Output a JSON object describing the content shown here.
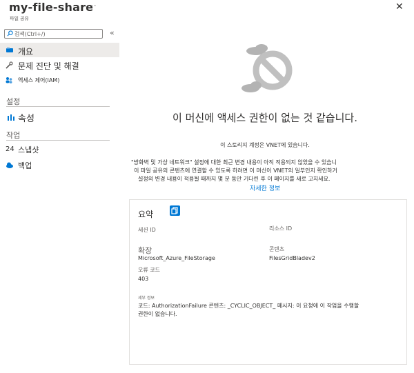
{
  "header": {
    "title": "my-file-share",
    "subtitle": "파일 공유",
    "more_glyph": "···",
    "close_glyph": "✕"
  },
  "search": {
    "placeholder": "검색(Ctrl+/)",
    "collapse_glyph": "«"
  },
  "nav": {
    "overview": "개요",
    "diagnose": "문제 진단 및 해결",
    "iam": "액세스 제어(IAM)",
    "section_settings": "설정",
    "properties": "속성",
    "section_operations": "작업",
    "snapshots_prefix": "24",
    "snapshots": "스냅샷",
    "backup": "백업"
  },
  "main": {
    "heading": "이 머신에 액세스 권한이 없는 것 같습니다.",
    "line1": "이 스토리지 계정은 VNET에 있습니다.",
    "line2": "\"방화벽 및 가상 네트워크\" 설정에 대한 최근 변경 내용이 아직 적용되지 않았을 수 있습니",
    "line3": "이 파일 공유의 콘텐츠에 연결할 수 있도록 하려면 이 머신이 VNET의 일부인지 확인하거",
    "line4": "설정의 변경 내용이 적용될 때까지 몇 분 동안 기다린 후 이 페이지를 새로 고치세요.",
    "learn_more": "자세한 정보"
  },
  "summary": {
    "title": "요약",
    "session_id_label": "세션 ID",
    "session_id_value": "",
    "resource_id_label": "리소스 ID",
    "resource_id_value": "",
    "extension_label": "확장",
    "extension_value": "Microsoft_Azure_FileStorage",
    "content_label": "콘텐츠",
    "content_value": "FilesGridBladev2",
    "error_code_label": "오류 코드",
    "error_code_value": "403",
    "details_label": "세부 정보",
    "details_line1": "코드: AuthorizationFailure 콘텐츠: _CYCLIC_OBJECT_ 메시지: 이 요청에 이 작업을 수행할",
    "details_line2": "권한이 없습니다."
  },
  "colors": {
    "accent": "#0078d4",
    "nav_selected_bg": "#edebe9",
    "icon_cloud": "#a8a8a8"
  }
}
